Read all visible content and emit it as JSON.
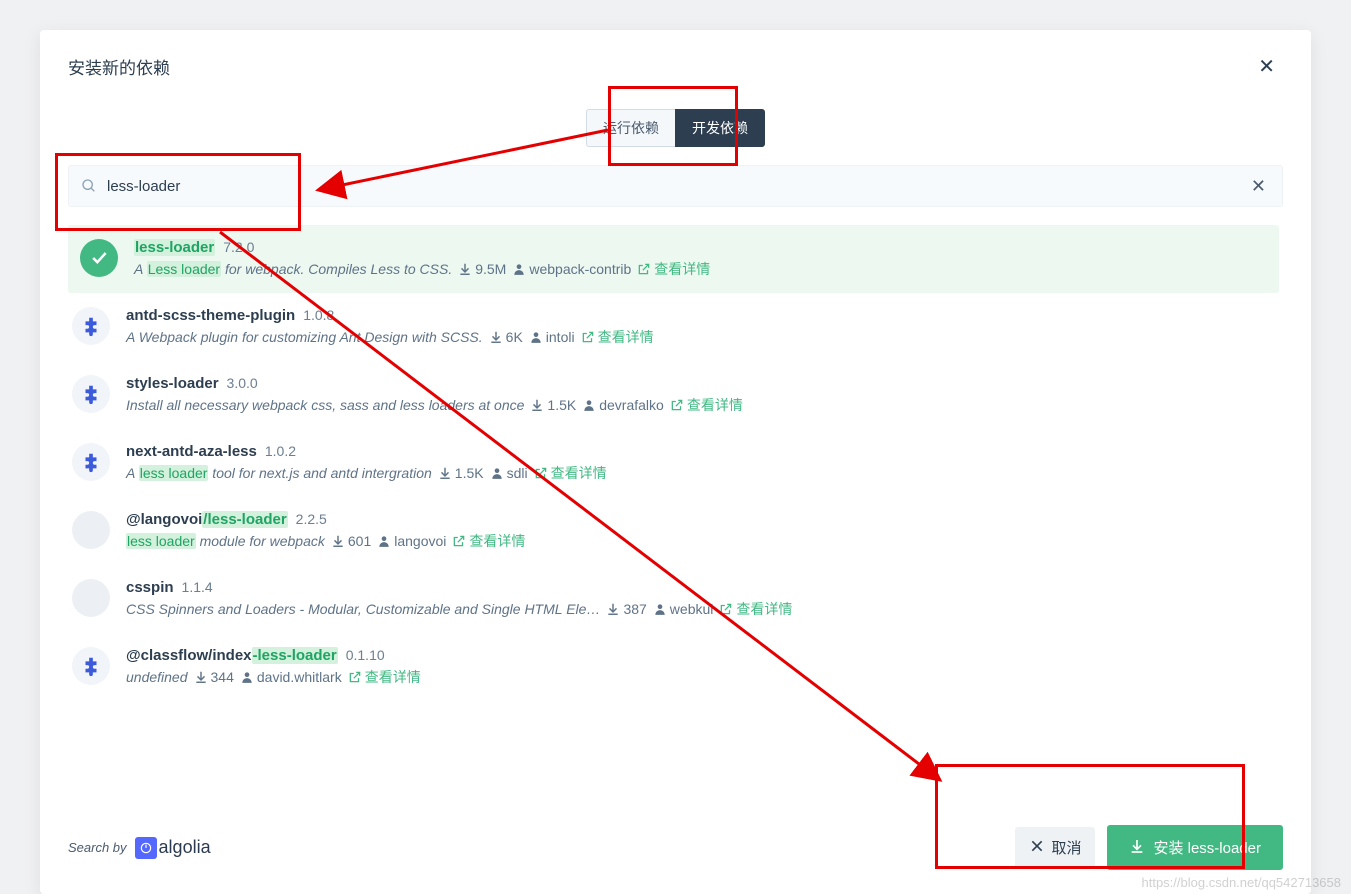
{
  "modal_title": "安装新的依赖",
  "close_label": "✕",
  "tabs": {
    "runtime": "运行依赖",
    "dev": "开发依赖"
  },
  "search": {
    "value": "less-loader",
    "clear": "✕"
  },
  "details_label": "查看详情",
  "results": [
    {
      "name_parts": [
        "less-loader"
      ],
      "name_highlighted": [
        0
      ],
      "version": "7.2.0",
      "desc_parts": [
        "A ",
        "Less loader",
        " for webpack. Compiles Less to CSS."
      ],
      "desc_highlighted": [
        1
      ],
      "downloads": "9.5M",
      "owner": "webpack-contrib",
      "selected": true,
      "badge": "check"
    },
    {
      "name_parts": [
        "antd-scss-theme-plugin"
      ],
      "name_highlighted": [],
      "version": "1.0.8",
      "desc_parts": [
        "A Webpack plugin for customizing Ant Design with SCSS."
      ],
      "desc_highlighted": [],
      "downloads": "6K",
      "owner": "intoli",
      "selected": false,
      "badge": "plugin"
    },
    {
      "name_parts": [
        "styles-loader"
      ],
      "name_highlighted": [],
      "version": "3.0.0",
      "desc_parts": [
        "Install all necessary webpack css, sass and less loaders at once"
      ],
      "desc_highlighted": [],
      "downloads": "1.5K",
      "owner": "devrafalko",
      "selected": false,
      "badge": "plugin"
    },
    {
      "name_parts": [
        "next-antd-aza-less"
      ],
      "name_highlighted": [],
      "version": "1.0.2",
      "desc_parts": [
        "A ",
        "less loader",
        " tool for next.js and antd intergration"
      ],
      "desc_highlighted": [
        1
      ],
      "downloads": "1.5K",
      "owner": "sdli",
      "selected": false,
      "badge": "plugin"
    },
    {
      "name_parts": [
        "@langovoi",
        "/less-loader"
      ],
      "name_highlighted": [
        1
      ],
      "version": "2.2.5",
      "desc_parts": [
        "less loader",
        " module for webpack"
      ],
      "desc_highlighted": [
        0
      ],
      "downloads": "601",
      "owner": "langovoi",
      "selected": false,
      "badge": "blank"
    },
    {
      "name_parts": [
        "csspin"
      ],
      "name_highlighted": [],
      "version": "1.1.4",
      "desc_parts": [
        "CSS Spinners and Loaders - Modular, Customizable and Single HTML Ele…"
      ],
      "desc_highlighted": [],
      "downloads": "387",
      "owner": "webkul",
      "selected": false,
      "badge": "blank"
    },
    {
      "name_parts": [
        "@classflow/index",
        "-less-loader"
      ],
      "name_highlighted": [
        1
      ],
      "version": "0.1.10",
      "desc_parts": [
        "undefined"
      ],
      "desc_highlighted": [],
      "downloads": "344",
      "owner": "david.whitlark",
      "selected": false,
      "badge": "plugin"
    }
  ],
  "search_by": "Search by",
  "algolia": "algolia",
  "cancel_label": "取消",
  "install_prefix": "安装 ",
  "install_target": "less-loader",
  "watermark": "https://blog.csdn.net/qq542713658"
}
